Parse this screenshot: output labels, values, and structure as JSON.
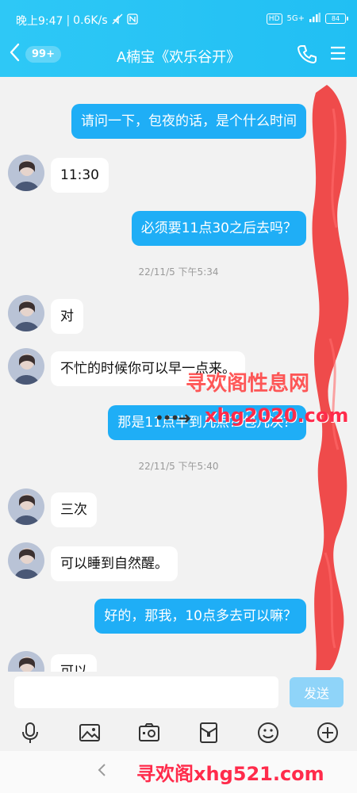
{
  "status_bar": {
    "time": "晚上9:47",
    "speed": "0.6K/s",
    "hd": "HD",
    "network": "5G+",
    "battery": "84"
  },
  "header": {
    "unread_count": "99+",
    "title": "A楠宝《欢乐谷开》"
  },
  "messages": [
    {
      "side": "out",
      "text": "请问一下，包夜的话，是个什么时间"
    },
    {
      "side": "in",
      "text": "11:30"
    },
    {
      "side": "out",
      "text": "必须要11点30之后去吗？"
    },
    {
      "type": "time",
      "text": "22/11/5 下午5:34"
    },
    {
      "side": "in",
      "text": "对"
    },
    {
      "side": "in",
      "text": "不忙的时候你可以早一点来。"
    },
    {
      "side": "out",
      "text": "那是11点半到几点？包几次？"
    },
    {
      "type": "time",
      "text": "22/11/5 下午5:40"
    },
    {
      "side": "in",
      "text": "三次"
    },
    {
      "side": "in",
      "text": "可以睡到自然醒。"
    },
    {
      "side": "out",
      "text": "好的，那我，10点多去可以嘛？"
    },
    {
      "side": "in",
      "text": "可以"
    }
  ],
  "watermarks": {
    "top": "寻欢阁性息网",
    "middle": "xhg2020.com",
    "bottom": "寻欢阁xhg521.com"
  },
  "input": {
    "value": "",
    "send_label": "发送"
  },
  "toolbar_icons": [
    "microphone-icon",
    "image-icon",
    "camera-icon",
    "red-packet-icon",
    "emoji-icon",
    "plus-icon"
  ],
  "colors": {
    "header": "#21bff3",
    "outgoing_bubble": "#1faef6",
    "incoming_bubble": "#ffffff",
    "send_button": "#8fd4f9",
    "scribble": "#ef4b4b",
    "watermark": "#ff2b4b"
  }
}
